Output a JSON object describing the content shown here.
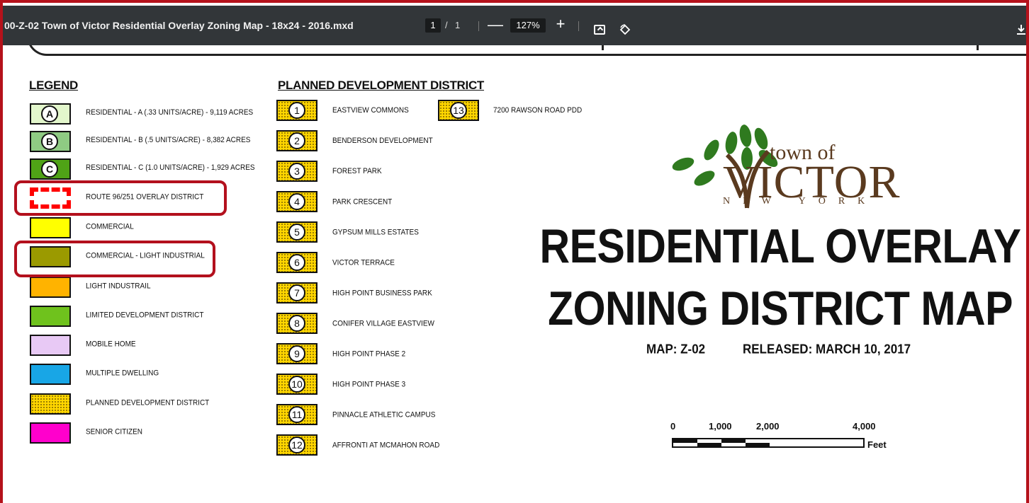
{
  "toolbar": {
    "title": "00-Z-02 Town of Victor Residential Overlay Zoning Map - 18x24 - 2016.mxd",
    "current_page": "1",
    "page_separator": "/",
    "total_pages": "1",
    "zoom_out": "—",
    "zoom": "127%",
    "zoom_in": "+",
    "fit_icon": "fit-to-page-icon",
    "rotate_icon": "rotate-icon",
    "download_icon": "download-icon"
  },
  "legend": {
    "heading": "LEGEND",
    "items": [
      {
        "letter": "A",
        "label": "RESIDENTIAL - A  (.33 UNITS/ACRE) - 9,119 ACRES",
        "color": "#e3f7cc"
      },
      {
        "letter": "B",
        "label": "RESIDENTIAL - B  (.5 UNITS/ACRE) - 8,382 ACRES",
        "color": "#8fcb83"
      },
      {
        "letter": "C",
        "label": "RESIDENTIAL - C  (1.0 UNITS/ACRE) - 1,929 ACRES",
        "color": "#4fa316"
      },
      {
        "label": "ROUTE 96/251 OVERLAY DISTRICT",
        "color": "#ff0000"
      },
      {
        "label": "COMMERCIAL",
        "color": "#ffff00"
      },
      {
        "label": "COMMERCIAL - LIGHT INDUSTRIAL",
        "color": "#9b9a00"
      },
      {
        "label": "LIGHT INDUSTRAIL",
        "color": "#ffb300"
      },
      {
        "label": "LIMITED DEVELOPMENT DISTRICT",
        "color": "#6fc21d"
      },
      {
        "label": "MOBILE HOME",
        "color": "#e8c9f5"
      },
      {
        "label": "MULTIPLE DWELLING",
        "color": "#18a6e6"
      },
      {
        "label": "PLANNED DEVELOPMENT DISTRICT",
        "color": "#ffd600"
      },
      {
        "label": "SENIOR CITIZEN",
        "color": "#ff00cc"
      }
    ]
  },
  "pdd": {
    "heading": "PLANNED DEVELOPMENT DISTRICT",
    "items": [
      {
        "num": "1",
        "label": "EASTVIEW COMMONS"
      },
      {
        "num": "2",
        "label": "BENDERSON DEVELOPMENT"
      },
      {
        "num": "3",
        "label": "FOREST PARK"
      },
      {
        "num": "4",
        "label": "PARK CRESCENT"
      },
      {
        "num": "5",
        "label": "GYPSUM MILLS ESTATES"
      },
      {
        "num": "6",
        "label": "VICTOR TERRACE"
      },
      {
        "num": "7",
        "label": "HIGH POINT BUSINESS PARK"
      },
      {
        "num": "8",
        "label": "CONIFER VILLAGE EASTVIEW"
      },
      {
        "num": "9",
        "label": "HIGH POINT PHASE 2"
      },
      {
        "num": "10",
        "label": "HIGH POINT PHASE 3"
      },
      {
        "num": "11",
        "label": "PINNACLE ATHLETIC CAMPUS"
      },
      {
        "num": "12",
        "label": "AFFRONTI AT MCMAHON ROAD"
      },
      {
        "num": "13",
        "label": "7200 RAWSON ROAD PDD"
      }
    ]
  },
  "logo": {
    "town_of": "town of",
    "victor": "VICTOR",
    "new_york": "NEW YORK",
    "leaf_color": "#2f7a1f",
    "trunk_color": "#5a3a1f"
  },
  "title": {
    "line1": "RESIDENTIAL OVERLAY",
    "line2": "ZONING DISTRICT MAP",
    "map": "MAP:  Z-02",
    "released": "RELEASED: MARCH 10, 2017"
  },
  "scale": {
    "labels": [
      "0",
      "1,000",
      "2,000",
      "4,000"
    ],
    "unit": "Feet"
  },
  "colors": {
    "highlight": "#b3101d",
    "toolbar_bg": "#323639"
  }
}
